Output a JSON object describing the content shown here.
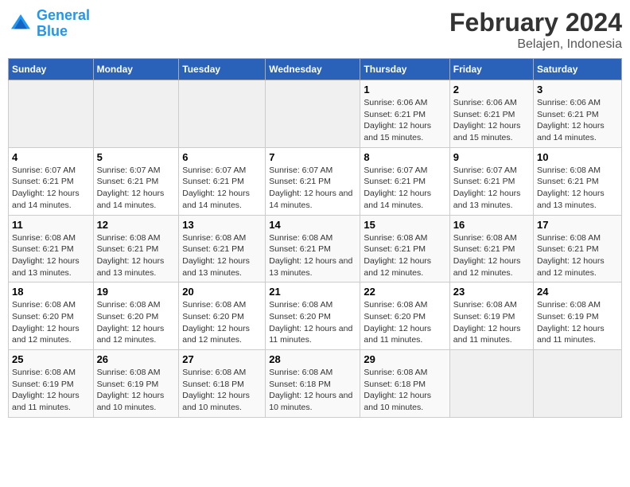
{
  "header": {
    "logo_text_general": "General",
    "logo_text_blue": "Blue",
    "title": "February 2024",
    "subtitle": "Belajen, Indonesia"
  },
  "days_of_week": [
    "Sunday",
    "Monday",
    "Tuesday",
    "Wednesday",
    "Thursday",
    "Friday",
    "Saturday"
  ],
  "weeks": [
    {
      "days": [
        {
          "num": "",
          "empty": true
        },
        {
          "num": "",
          "empty": true
        },
        {
          "num": "",
          "empty": true
        },
        {
          "num": "",
          "empty": true
        },
        {
          "num": "1",
          "sunrise": "Sunrise: 6:06 AM",
          "sunset": "Sunset: 6:21 PM",
          "daylight": "Daylight: 12 hours and 15 minutes."
        },
        {
          "num": "2",
          "sunrise": "Sunrise: 6:06 AM",
          "sunset": "Sunset: 6:21 PM",
          "daylight": "Daylight: 12 hours and 15 minutes."
        },
        {
          "num": "3",
          "sunrise": "Sunrise: 6:06 AM",
          "sunset": "Sunset: 6:21 PM",
          "daylight": "Daylight: 12 hours and 14 minutes."
        }
      ]
    },
    {
      "days": [
        {
          "num": "4",
          "sunrise": "Sunrise: 6:07 AM",
          "sunset": "Sunset: 6:21 PM",
          "daylight": "Daylight: 12 hours and 14 minutes."
        },
        {
          "num": "5",
          "sunrise": "Sunrise: 6:07 AM",
          "sunset": "Sunset: 6:21 PM",
          "daylight": "Daylight: 12 hours and 14 minutes."
        },
        {
          "num": "6",
          "sunrise": "Sunrise: 6:07 AM",
          "sunset": "Sunset: 6:21 PM",
          "daylight": "Daylight: 12 hours and 14 minutes."
        },
        {
          "num": "7",
          "sunrise": "Sunrise: 6:07 AM",
          "sunset": "Sunset: 6:21 PM",
          "daylight": "Daylight: 12 hours and 14 minutes."
        },
        {
          "num": "8",
          "sunrise": "Sunrise: 6:07 AM",
          "sunset": "Sunset: 6:21 PM",
          "daylight": "Daylight: 12 hours and 14 minutes."
        },
        {
          "num": "9",
          "sunrise": "Sunrise: 6:07 AM",
          "sunset": "Sunset: 6:21 PM",
          "daylight": "Daylight: 12 hours and 13 minutes."
        },
        {
          "num": "10",
          "sunrise": "Sunrise: 6:08 AM",
          "sunset": "Sunset: 6:21 PM",
          "daylight": "Daylight: 12 hours and 13 minutes."
        }
      ]
    },
    {
      "days": [
        {
          "num": "11",
          "sunrise": "Sunrise: 6:08 AM",
          "sunset": "Sunset: 6:21 PM",
          "daylight": "Daylight: 12 hours and 13 minutes."
        },
        {
          "num": "12",
          "sunrise": "Sunrise: 6:08 AM",
          "sunset": "Sunset: 6:21 PM",
          "daylight": "Daylight: 12 hours and 13 minutes."
        },
        {
          "num": "13",
          "sunrise": "Sunrise: 6:08 AM",
          "sunset": "Sunset: 6:21 PM",
          "daylight": "Daylight: 12 hours and 13 minutes."
        },
        {
          "num": "14",
          "sunrise": "Sunrise: 6:08 AM",
          "sunset": "Sunset: 6:21 PM",
          "daylight": "Daylight: 12 hours and 13 minutes."
        },
        {
          "num": "15",
          "sunrise": "Sunrise: 6:08 AM",
          "sunset": "Sunset: 6:21 PM",
          "daylight": "Daylight: 12 hours and 12 minutes."
        },
        {
          "num": "16",
          "sunrise": "Sunrise: 6:08 AM",
          "sunset": "Sunset: 6:21 PM",
          "daylight": "Daylight: 12 hours and 12 minutes."
        },
        {
          "num": "17",
          "sunrise": "Sunrise: 6:08 AM",
          "sunset": "Sunset: 6:21 PM",
          "daylight": "Daylight: 12 hours and 12 minutes."
        }
      ]
    },
    {
      "days": [
        {
          "num": "18",
          "sunrise": "Sunrise: 6:08 AM",
          "sunset": "Sunset: 6:20 PM",
          "daylight": "Daylight: 12 hours and 12 minutes."
        },
        {
          "num": "19",
          "sunrise": "Sunrise: 6:08 AM",
          "sunset": "Sunset: 6:20 PM",
          "daylight": "Daylight: 12 hours and 12 minutes."
        },
        {
          "num": "20",
          "sunrise": "Sunrise: 6:08 AM",
          "sunset": "Sunset: 6:20 PM",
          "daylight": "Daylight: 12 hours and 12 minutes."
        },
        {
          "num": "21",
          "sunrise": "Sunrise: 6:08 AM",
          "sunset": "Sunset: 6:20 PM",
          "daylight": "Daylight: 12 hours and 11 minutes."
        },
        {
          "num": "22",
          "sunrise": "Sunrise: 6:08 AM",
          "sunset": "Sunset: 6:20 PM",
          "daylight": "Daylight: 12 hours and 11 minutes."
        },
        {
          "num": "23",
          "sunrise": "Sunrise: 6:08 AM",
          "sunset": "Sunset: 6:19 PM",
          "daylight": "Daylight: 12 hours and 11 minutes."
        },
        {
          "num": "24",
          "sunrise": "Sunrise: 6:08 AM",
          "sunset": "Sunset: 6:19 PM",
          "daylight": "Daylight: 12 hours and 11 minutes."
        }
      ]
    },
    {
      "days": [
        {
          "num": "25",
          "sunrise": "Sunrise: 6:08 AM",
          "sunset": "Sunset: 6:19 PM",
          "daylight": "Daylight: 12 hours and 11 minutes."
        },
        {
          "num": "26",
          "sunrise": "Sunrise: 6:08 AM",
          "sunset": "Sunset: 6:19 PM",
          "daylight": "Daylight: 12 hours and 10 minutes."
        },
        {
          "num": "27",
          "sunrise": "Sunrise: 6:08 AM",
          "sunset": "Sunset: 6:18 PM",
          "daylight": "Daylight: 12 hours and 10 minutes."
        },
        {
          "num": "28",
          "sunrise": "Sunrise: 6:08 AM",
          "sunset": "Sunset: 6:18 PM",
          "daylight": "Daylight: 12 hours and 10 minutes."
        },
        {
          "num": "29",
          "sunrise": "Sunrise: 6:08 AM",
          "sunset": "Sunset: 6:18 PM",
          "daylight": "Daylight: 12 hours and 10 minutes."
        },
        {
          "num": "",
          "empty": true
        },
        {
          "num": "",
          "empty": true
        }
      ]
    }
  ]
}
